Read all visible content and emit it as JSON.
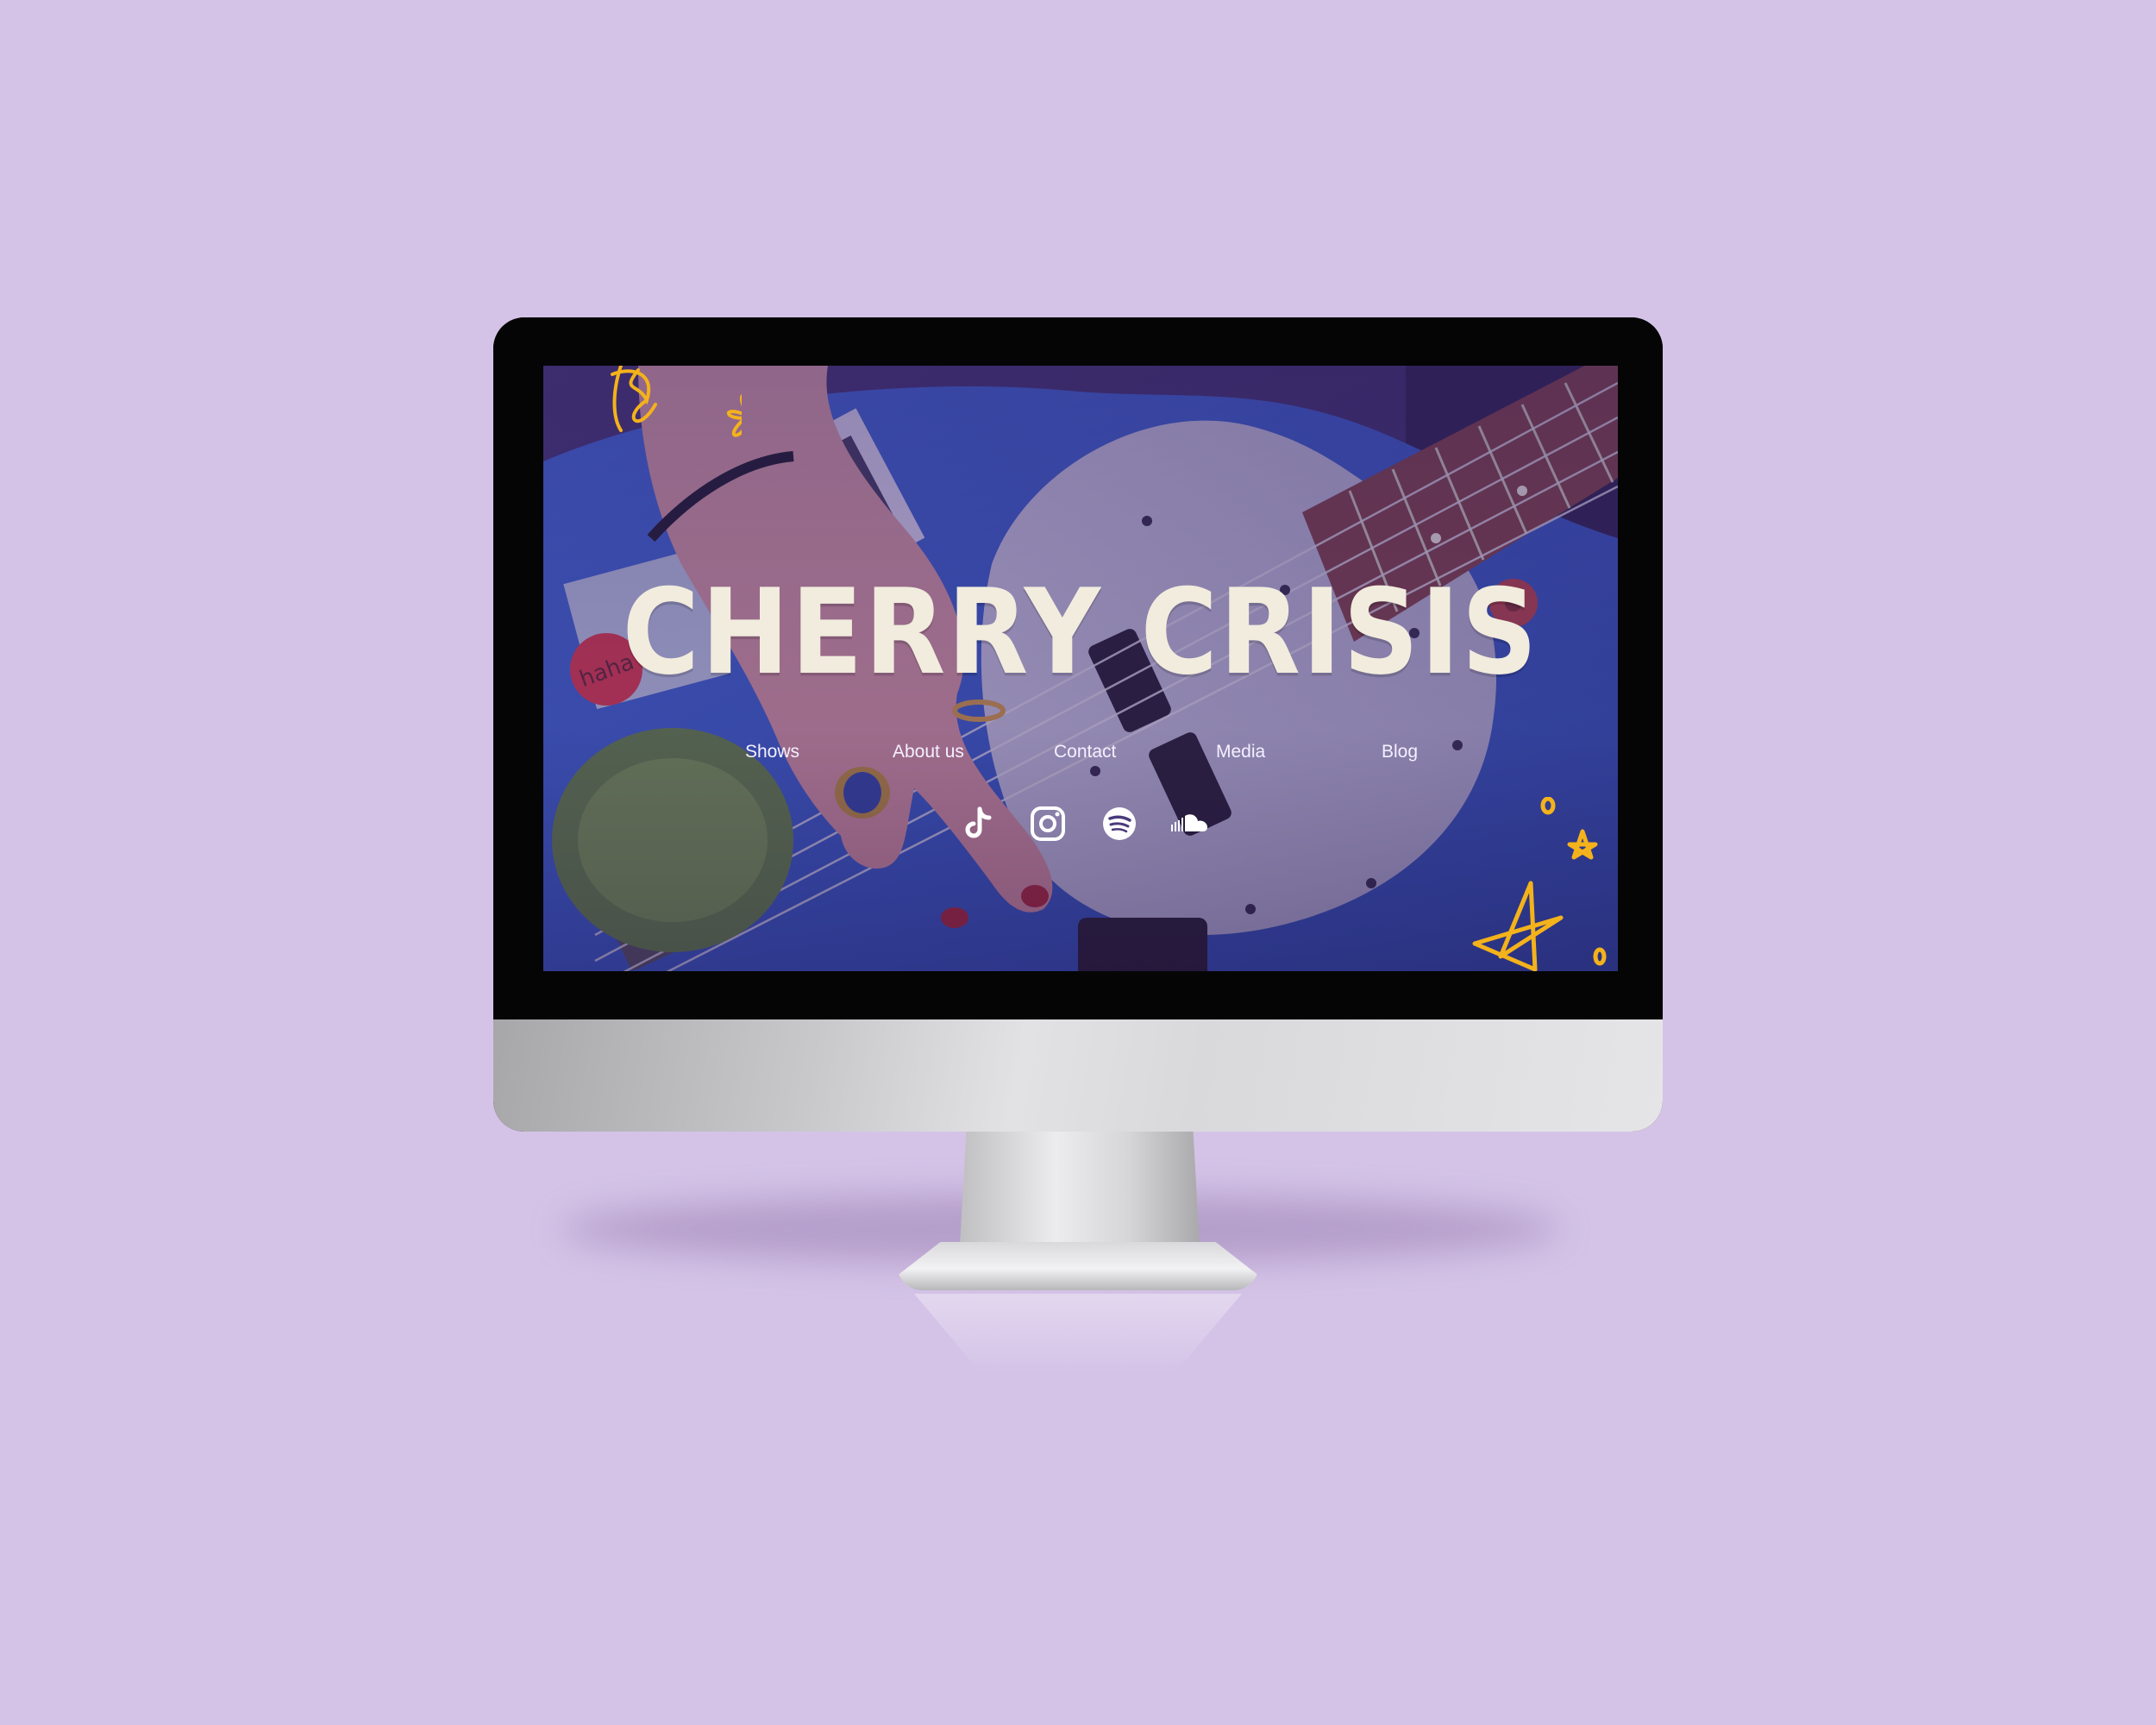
{
  "site": {
    "title": "CHERRY CRISIS"
  },
  "nav": {
    "items": [
      {
        "label": "Shows"
      },
      {
        "label": "About us"
      },
      {
        "label": "Contact"
      },
      {
        "label": "Media"
      },
      {
        "label": "Blog"
      }
    ]
  },
  "socials": [
    {
      "icon": "tiktok-icon"
    },
    {
      "icon": "instagram-icon"
    },
    {
      "icon": "spotify-icon"
    },
    {
      "icon": "soundcloud-icon"
    }
  ],
  "photo": {
    "sticker_text": "haha"
  },
  "colors": {
    "background": "#d4c3e7",
    "title": "#f1ecdd",
    "doodle": "#f4b21b",
    "bass_body": "#2c4fb8"
  }
}
